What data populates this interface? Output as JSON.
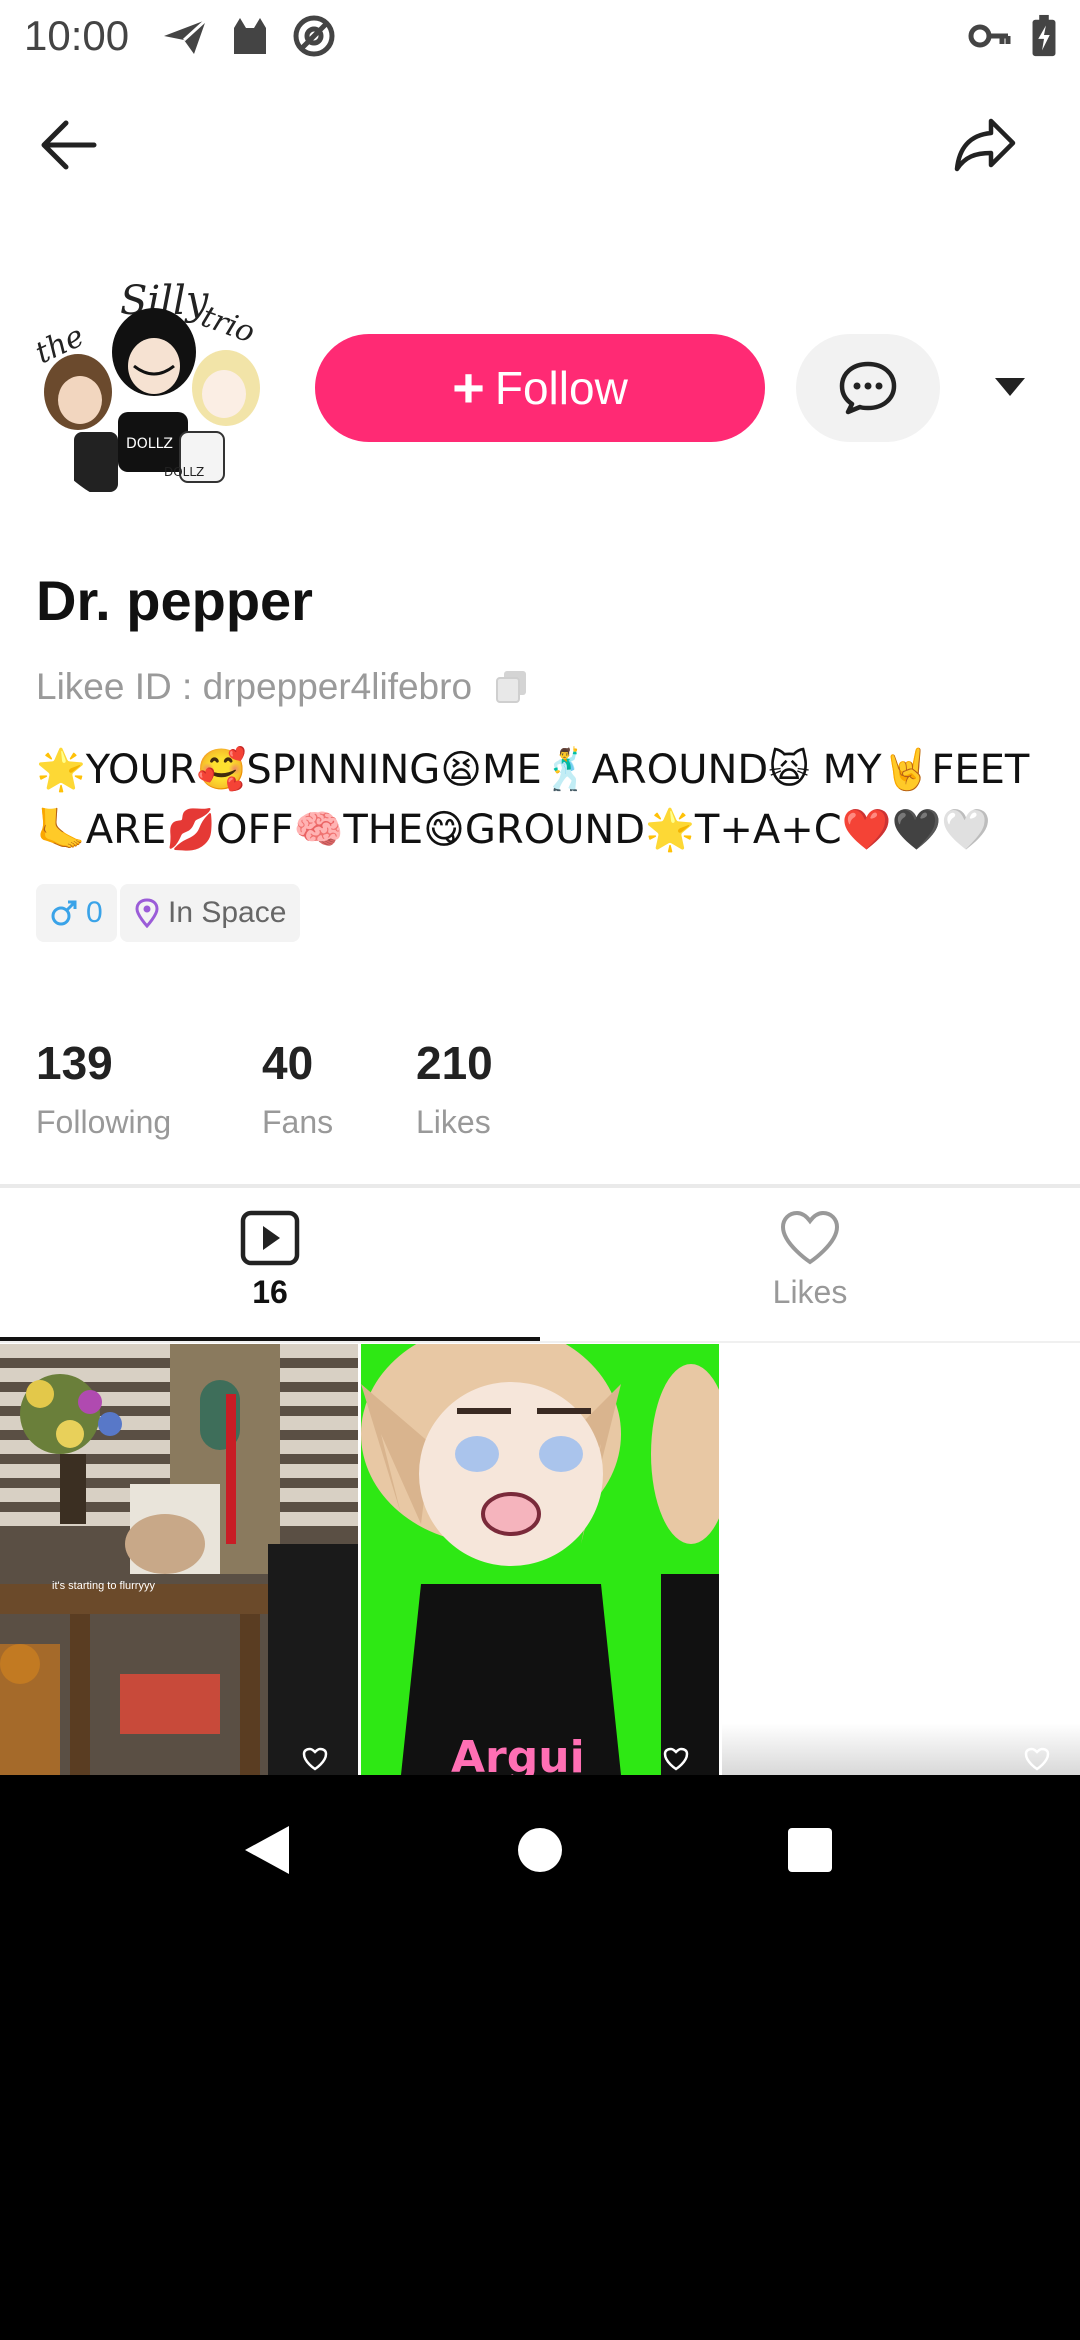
{
  "status_bar": {
    "time": "10:00",
    "icons_left": [
      "send-icon",
      "cat-icon",
      "at-sign-icon"
    ],
    "icons_right": [
      "key-icon",
      "battery-charging-icon"
    ]
  },
  "top_bar": {
    "back_icon": "arrow-left-icon",
    "share_icon": "share-arrow-icon"
  },
  "profile": {
    "avatar_icon": "avatar-drawing",
    "follow_label": "Follow",
    "follow_icon": "plus-icon",
    "message_icon": "chat-bubble-icon",
    "more_icon": "caret-down-icon",
    "name": "Dr. pepper",
    "likee_id": "Likee ID : drpepper4lifebro",
    "copy_icon": "copy-icon",
    "bio": "🌟YOUR🥰SPINNING😫ME🕺AROUND🙀 MY🤘FEET 🦶ARE💋OFF🧠THE😋GROUND🌟T+A+C❤️🖤🤍",
    "tags": {
      "gender_value": "0",
      "gender_icon": "male-icon",
      "location": "In Space",
      "location_icon": "location-pin-icon"
    }
  },
  "stats": [
    {
      "value": "139",
      "label": "Following"
    },
    {
      "value": "40",
      "label": "Fans"
    },
    {
      "value": "210",
      "label": "Likes"
    }
  ],
  "tabs": [
    {
      "label": "16",
      "icon": "video-play-icon",
      "active": true
    },
    {
      "label": "Likes",
      "icon": "heart-icon",
      "active": false
    }
  ],
  "videos": [
    {
      "caption": "it's starting to flurryyy"
    },
    {},
    {}
  ],
  "nav_bar": {
    "back": "nav-back-icon",
    "home": "nav-home-icon",
    "recents": "nav-recents-icon"
  },
  "colors": {
    "accent": "#ff2a74",
    "message_bg": "#f2f2f2",
    "gender_blue": "#3aa3e8",
    "muted_text": "#9a9a9a"
  }
}
